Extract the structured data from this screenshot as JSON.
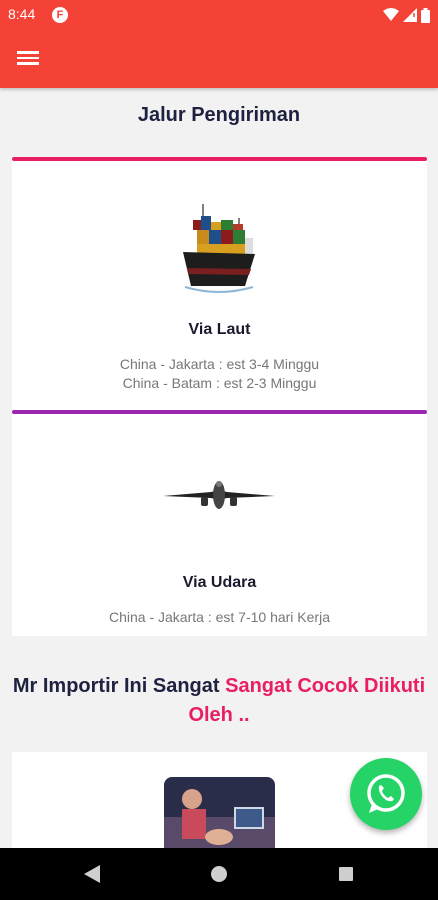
{
  "status_bar": {
    "time": "8:44",
    "badge": "F"
  },
  "page": {
    "title": "Jalur Pengiriman"
  },
  "shipping": [
    {
      "title": "Via Laut",
      "lines": [
        "China - Jakarta : est 3-4 Minggu",
        "China - Batam : est 2-3 Minggu"
      ],
      "accent": "#e91e63",
      "icon": "cargo-ship"
    },
    {
      "title": "Via Udara",
      "lines": [
        "China - Jakarta : est 7-10 hari Kerja"
      ],
      "accent": "#9c27b0",
      "icon": "airplane"
    }
  ],
  "promo": {
    "text_plain": "Mr Importir Ini Sangat ",
    "text_highlight": "Sangat Cocok Diikuti Oleh .."
  },
  "colors": {
    "primary": "#f44336",
    "highlight": "#e91e63",
    "whatsapp": "#25d366"
  }
}
